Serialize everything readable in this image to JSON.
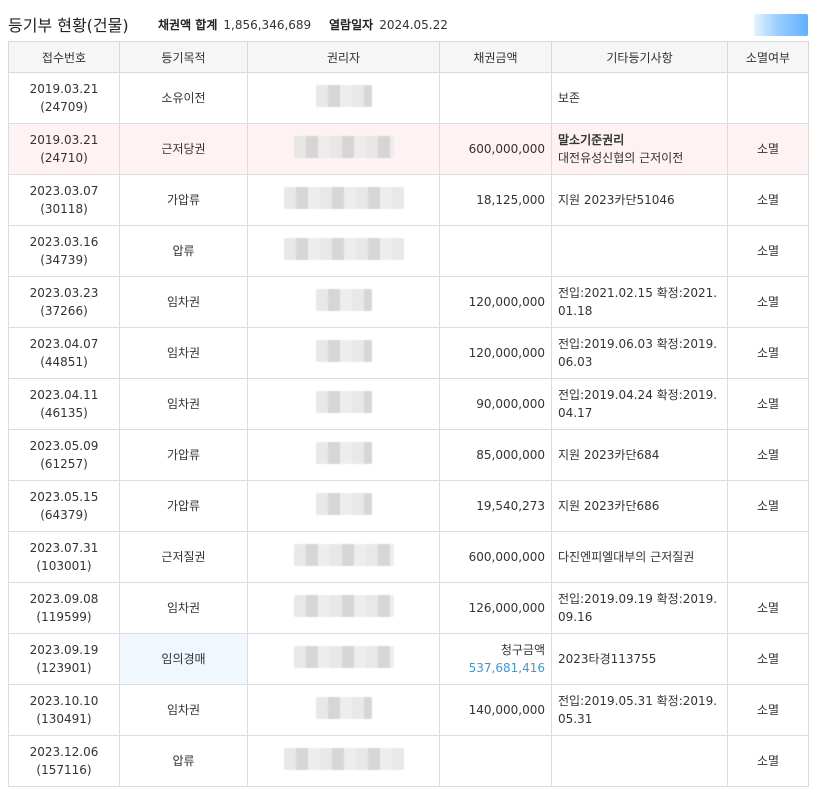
{
  "header": {
    "title": "등기부 현황(건물)",
    "total_label": "채권액 합계",
    "total_value": "1,856,346,689",
    "date_label": "열람일자",
    "date_value": "2024.05.22"
  },
  "table": {
    "columns": [
      "접수번호",
      "등기목적",
      "권리자",
      "채권금액",
      "기타등기사항",
      "소멸여부"
    ],
    "rows": [
      {
        "date": "2019.03.21",
        "no": "(24709)",
        "purpose": "소유이전",
        "holder_w": "w1",
        "amount": "",
        "other1": "보존",
        "other2": "",
        "ext": ""
      },
      {
        "date": "2019.03.21",
        "no": "(24710)",
        "purpose": "근저당권",
        "holder_w": "w2",
        "amount": "600,000,000",
        "other1": "말소기준권리",
        "other2": "대전유성신협의 근저이전",
        "ext": "소멸"
      },
      {
        "date": "2023.03.07",
        "no": "(30118)",
        "purpose": "가압류",
        "holder_w": "w3",
        "amount": "18,125,000",
        "other1": "지원 2023카단51046",
        "other2": "",
        "ext": "소멸"
      },
      {
        "date": "2023.03.16",
        "no": "(34739)",
        "purpose": "압류",
        "holder_w": "w3",
        "amount": "",
        "other1": "",
        "other2": "",
        "ext": "소멸"
      },
      {
        "date": "2023.03.23",
        "no": "(37266)",
        "purpose": "임차권",
        "holder_w": "w1",
        "amount": "120,000,000",
        "other1": "전입:2021.02.15 확정:2021.",
        "other2": "01.18",
        "ext": "소멸"
      },
      {
        "date": "2023.04.07",
        "no": "(44851)",
        "purpose": "임차권",
        "holder_w": "w1",
        "amount": "120,000,000",
        "other1": "전입:2019.06.03 확정:2019.",
        "other2": "06.03",
        "ext": "소멸"
      },
      {
        "date": "2023.04.11",
        "no": "(46135)",
        "purpose": "임차권",
        "holder_w": "w1",
        "amount": "90,000,000",
        "other1": "전입:2019.04.24 확정:2019.",
        "other2": "04.17",
        "ext": "소멸"
      },
      {
        "date": "2023.05.09",
        "no": "(61257)",
        "purpose": "가압류",
        "holder_w": "w1",
        "amount": "85,000,000",
        "other1": "지원 2023카단684",
        "other2": "",
        "ext": "소멸"
      },
      {
        "date": "2023.05.15",
        "no": "(64379)",
        "purpose": "가압류",
        "holder_w": "w1",
        "amount": "19,540,273",
        "other1": "지원 2023카단686",
        "other2": "",
        "ext": "소멸"
      },
      {
        "date": "2023.07.31",
        "no": "(103001)",
        "purpose": "근저질권",
        "holder_w": "w2",
        "amount": "600,000,000",
        "other1": "다진엔피엘대부의 근저질권",
        "other2": "",
        "ext": ""
      },
      {
        "date": "2023.09.08",
        "no": "(119599)",
        "purpose": "임차권",
        "holder_w": "w2",
        "amount": "126,000,000",
        "other1": "전입:2019.09.19 확정:2019.",
        "other2": "09.16",
        "ext": "소멸"
      },
      {
        "date": "2023.09.19",
        "no": "(123901)",
        "purpose": "임의경매",
        "holder_w": "w2",
        "amount": "",
        "amount_label": "청구금액",
        "amount_blue": "537,681,416",
        "other1": "2023타경113755",
        "other2": "",
        "ext": "소멸"
      },
      {
        "date": "2023.10.10",
        "no": "(130491)",
        "purpose": "임차권",
        "holder_w": "w1",
        "amount": "140,000,000",
        "other1": "전입:2019.05.31 확정:2019.",
        "other2": "05.31",
        "ext": "소멸"
      },
      {
        "date": "2023.12.06",
        "no": "(157116)",
        "purpose": "압류",
        "holder_w": "w3",
        "amount": "",
        "other1": "",
        "other2": "",
        "ext": "소멸"
      }
    ]
  }
}
